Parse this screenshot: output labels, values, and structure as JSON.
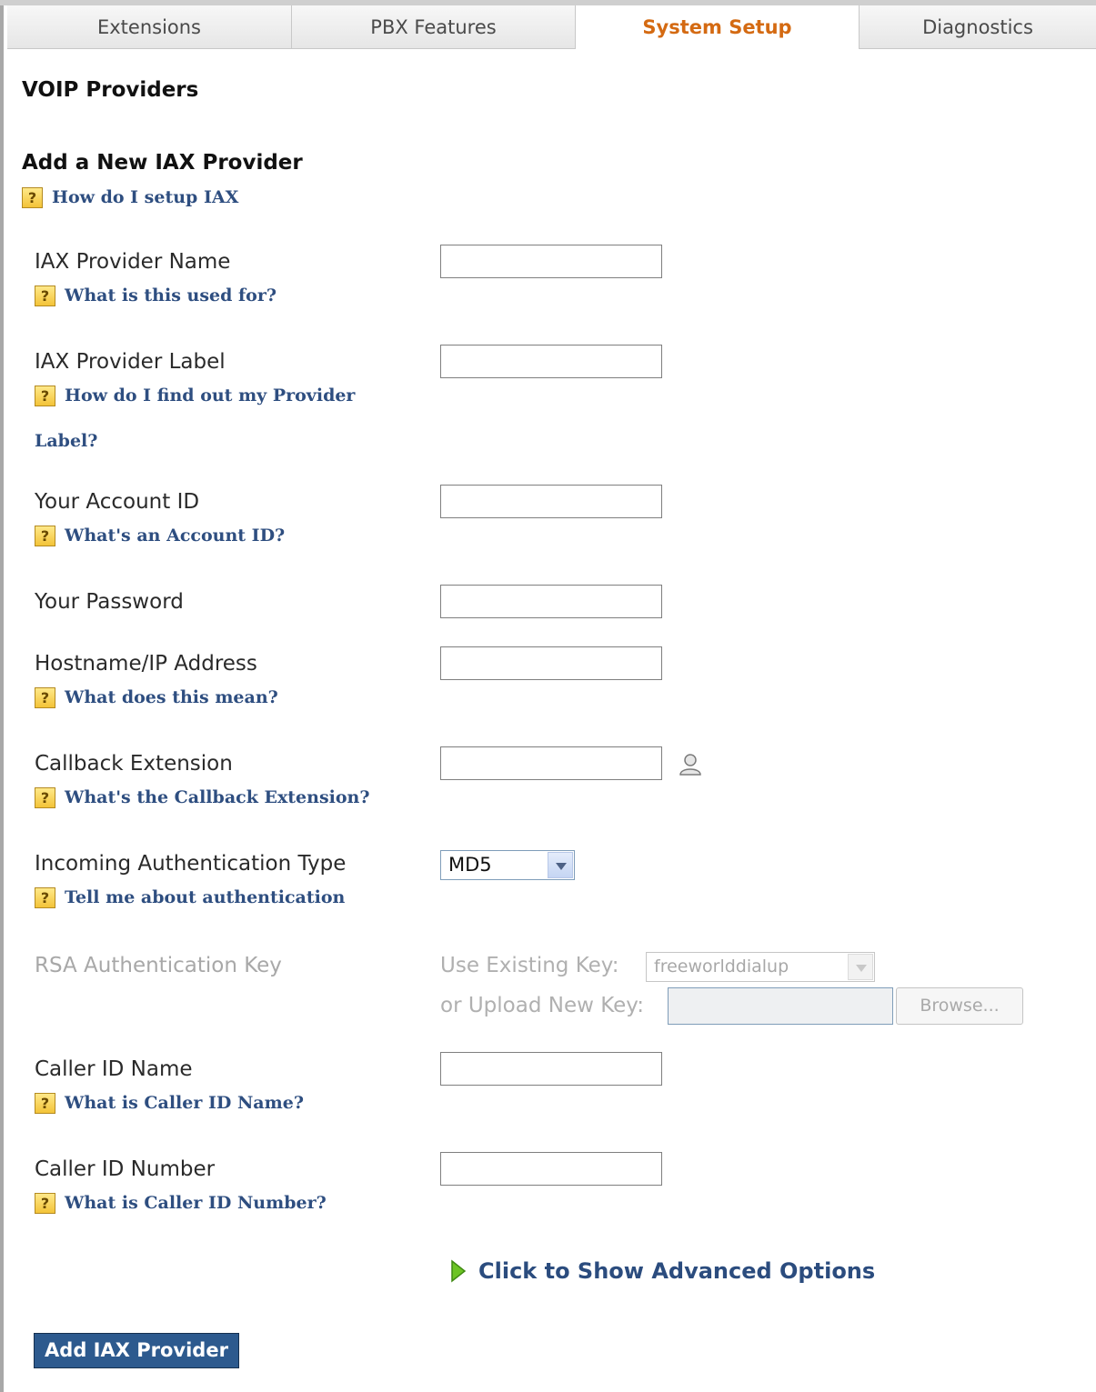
{
  "tabs": [
    {
      "label": "Extensions",
      "active": false
    },
    {
      "label": "PBX Features",
      "active": false
    },
    {
      "label": "System Setup",
      "active": true
    },
    {
      "label": "Diagnostics",
      "active": false
    }
  ],
  "page_title": "VOIP Providers",
  "section_title": "Add a New IAX Provider",
  "section_help": "How do I setup IAX",
  "fields": {
    "provider_name": {
      "label": "IAX Provider Name",
      "value": "",
      "help": "What is this used for?"
    },
    "provider_label": {
      "label": "IAX Provider Label",
      "value": "",
      "help_line1": "How do I find out my Provider",
      "help_line2": "Label?"
    },
    "account_id": {
      "label": "Your Account ID",
      "value": "",
      "help": "What's an Account ID?"
    },
    "password": {
      "label": "Your Password",
      "value": ""
    },
    "hostname": {
      "label": "Hostname/IP Address",
      "value": "",
      "help": "What does this mean?"
    },
    "callback_extension": {
      "label": "Callback Extension",
      "value": "",
      "help": "What's the Callback Extension?"
    },
    "auth_type": {
      "label": "Incoming Authentication Type",
      "value": "MD5",
      "help": "Tell me about authentication"
    },
    "rsa_key": {
      "label": "RSA Authentication Key",
      "use_existing_label": "Use Existing Key:",
      "existing_value": "freeworlddialup",
      "upload_label": "or Upload New Key:",
      "browse_label": "Browse..."
    },
    "caller_id_name": {
      "label": "Caller ID Name",
      "value": "",
      "help": "What is Caller ID Name?"
    },
    "caller_id_number": {
      "label": "Caller ID Number",
      "value": "",
      "help": "What is Caller ID Number?"
    }
  },
  "advanced_link": "Click to Show Advanced Options",
  "submit_label": "Add IAX Provider",
  "help_icon_glyph": "?",
  "icons": [
    "help-icon",
    "user-picker-icon",
    "expand-arrow-icon",
    "dropdown-arrow-icon"
  ],
  "colors": {
    "active_tab": "#d46a12",
    "link": "#2e4e80",
    "button": "#2d5a8e",
    "arrow": "#5aa51e"
  }
}
